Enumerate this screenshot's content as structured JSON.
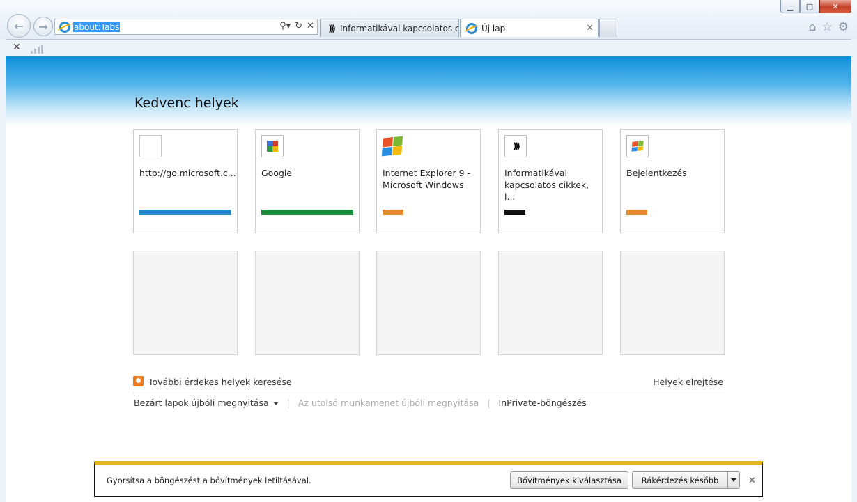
{
  "window": {
    "minimize_icon": "minimize-icon",
    "maximize_icon": "maximize-icon",
    "close_icon": "close-icon"
  },
  "toolbar": {
    "address": "about:Tabs",
    "search_icon": "search-icon",
    "refresh_icon": "refresh-icon",
    "stop_icon": "stop-icon"
  },
  "tabs": [
    {
      "label": "Informatikával kapcsolatos cik...",
      "active": false
    },
    {
      "label": "Új lap",
      "active": true
    }
  ],
  "page": {
    "title": "Kedvenc helyek",
    "tiles": [
      {
        "label": "http://go.microsoft.c...",
        "bar_color": "#1e88c8",
        "bar_fill": 1.0,
        "icon": "blank-page-icon"
      },
      {
        "label": "Google",
        "bar_color": "#1a8a3c",
        "bar_fill": 1.0,
        "icon": "google-icon"
      },
      {
        "label": "Internet Explorer 9 - Microsoft Windows",
        "bar_color": "#e08a2a",
        "bar_fill": 0.23,
        "icon": "windows-logo-icon"
      },
      {
        "label": "Informatikával kapcsolatos cikkek, l...",
        "bar_color": "#111111",
        "bar_fill": 0.23,
        "icon": "site-logo-icon"
      },
      {
        "label": "Bejelentkezés",
        "bar_color": "#e08a2a",
        "bar_fill": 0.23,
        "icon": "windows-logo-icon"
      }
    ],
    "more_sites": "További érdekes helyek keresése",
    "hide_sites": "Helyek elrejtése",
    "reopen_closed": "Bezárt lapok újbóli megnyitása",
    "reopen_session": "Az utolsó munkamenet újbóli megnyitása",
    "inprivate": "InPrivate-böngészés"
  },
  "notification": {
    "message": "Gyorsítsa a böngészést a bővítmények letiltásával.",
    "choose_button": "Bővítmények kiválasztása",
    "later_button": "Rákérdezés később"
  }
}
